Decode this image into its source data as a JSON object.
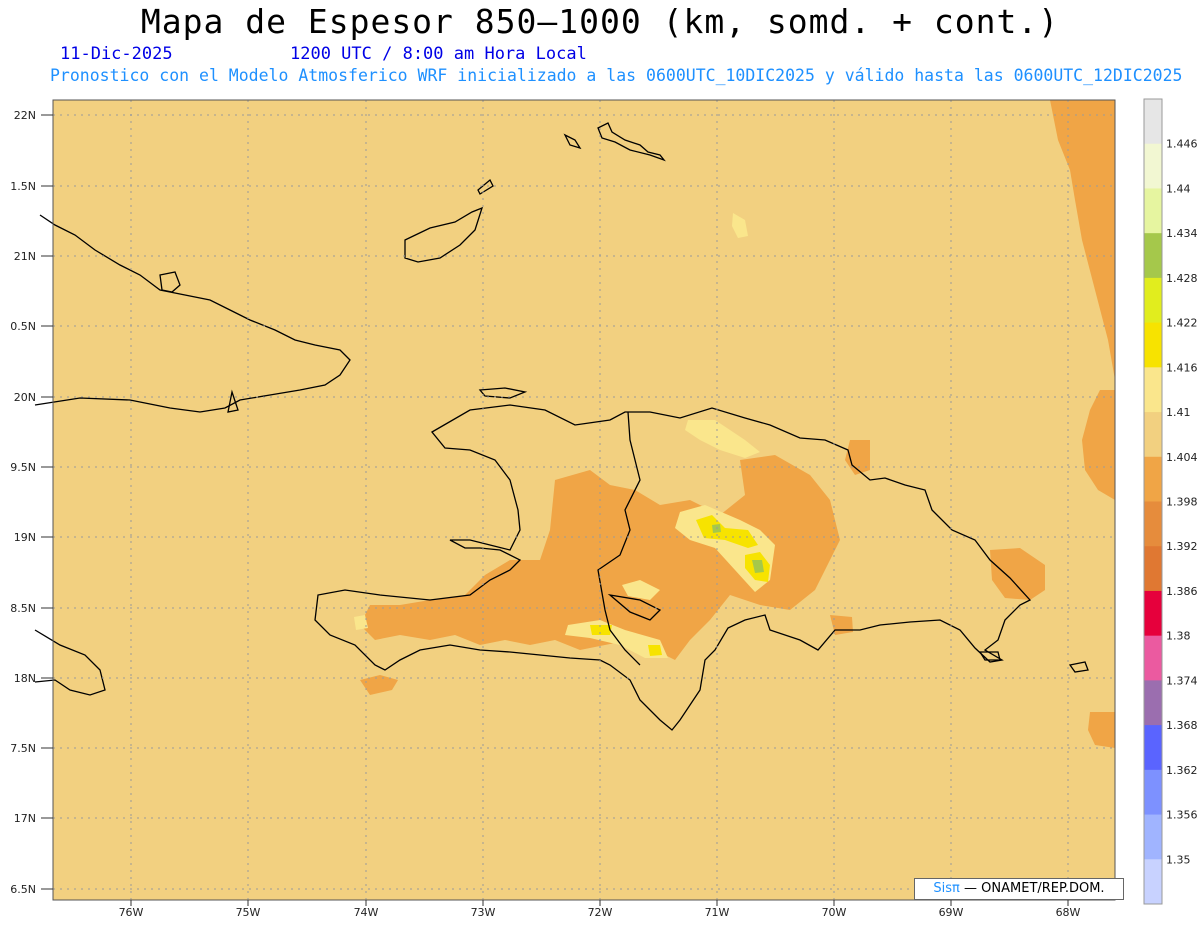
{
  "header": {
    "title": "Mapa de Espesor 850—1000 (km, somd. + cont.)",
    "date": "11-Dic-2025",
    "utc_local": "1200 UTC / 8:00 am Hora Local",
    "subtitle": "Pronostico con el Modelo Atmosferico WRF inicializado a las 0600UTC_10DIC2025 y válido hasta las  0600UTC_12DIC2025"
  },
  "map": {
    "lat_labels": [
      "22N",
      "1.5N",
      "21N",
      "0.5N",
      "20N",
      "9.5N",
      "19N",
      "8.5N",
      "18N",
      "7.5N",
      "17N",
      "6.5N"
    ],
    "lon_labels": [
      "76W",
      "75W",
      "74W",
      "73W",
      "72W",
      "71W",
      "70W",
      "69W",
      "68W"
    ],
    "background_color": "#f2d080",
    "coastline_color": "#000000"
  },
  "colorbar": {
    "levels": [
      "1.446",
      "1.44",
      "1.434",
      "1.428",
      "1.422",
      "1.416",
      "1.41",
      "1.404",
      "1.398",
      "1.392",
      "1.386",
      "1.38",
      "1.374",
      "1.368",
      "1.362",
      "1.356",
      "1.35"
    ],
    "colors": [
      "#e6e6e6",
      "#f2f7d2",
      "#e6f5a0",
      "#a5c84b",
      "#e1ed1e",
      "#f7e300",
      "#fae68c",
      "#f2d080",
      "#f0a546",
      "#e68c3c",
      "#e07832",
      "#e6003c",
      "#eb5aa0",
      "#9b6eaf",
      "#5a64ff",
      "#7d91ff",
      "#a0b4ff",
      "#c8d2ff"
    ]
  },
  "credit": {
    "brand": "Sisπ",
    "text": "— ONAMET/REP.DOM."
  }
}
